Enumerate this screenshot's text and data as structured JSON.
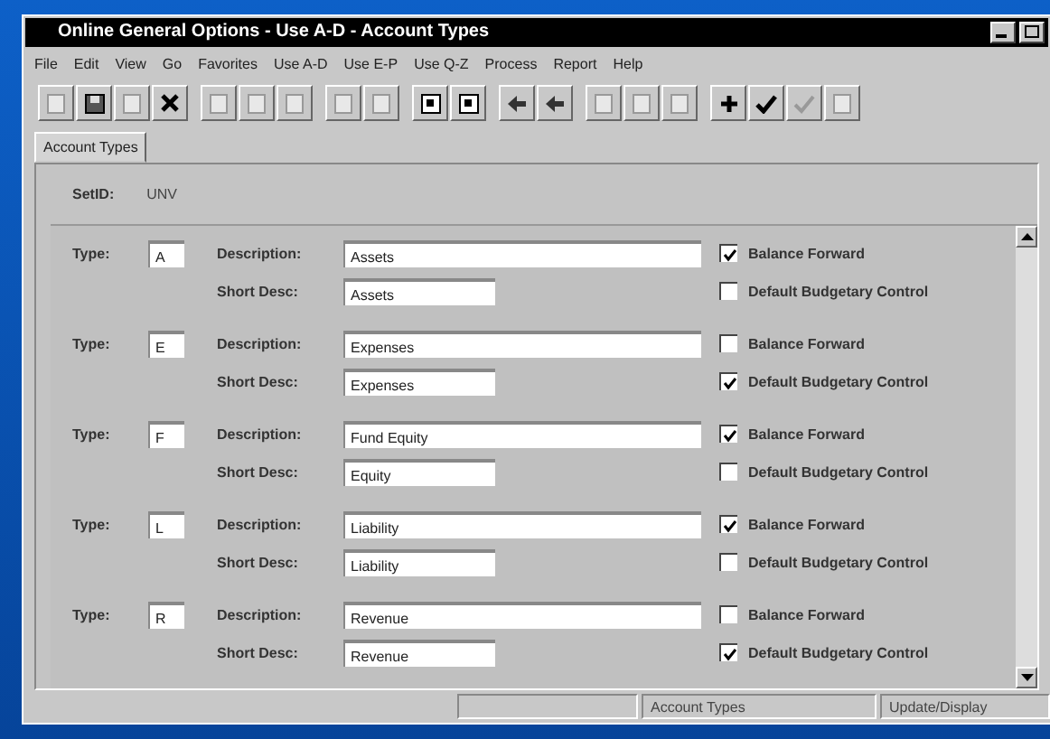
{
  "window": {
    "title": "Online General Options - Use A-D - Account Types"
  },
  "menu": [
    "File",
    "Edit",
    "View",
    "Go",
    "Favorites",
    "Use A-D",
    "Use E-P",
    "Use Q-Z",
    "Process",
    "Report",
    "Help"
  ],
  "tabs": [
    {
      "label": "Account Types",
      "selected": true
    }
  ],
  "setid": {
    "label": "SetID:",
    "value": "UNV"
  },
  "rows": [
    {
      "type_label": "Type:",
      "type": "A",
      "desc_label": "Description:",
      "desc": "Assets",
      "short_label": "Short Desc:",
      "short": "Assets",
      "checks": [
        {
          "label": "Balance Forward",
          "checked": true
        },
        {
          "label": "Default Budgetary Control",
          "checked": false
        }
      ]
    },
    {
      "type_label": "Type:",
      "type": "E",
      "desc_label": "Description:",
      "desc": "Expenses",
      "short_label": "Short Desc:",
      "short": "Expenses",
      "checks": [
        {
          "label": "Balance Forward",
          "checked": false
        },
        {
          "label": "Default Budgetary Control",
          "checked": true
        }
      ]
    },
    {
      "type_label": "Type:",
      "type": "F",
      "desc_label": "Description:",
      "desc": "Fund Equity",
      "short_label": "Short Desc:",
      "short": "Equity",
      "checks": [
        {
          "label": "Balance Forward",
          "checked": true
        },
        {
          "label": "Default Budgetary Control",
          "checked": false
        }
      ]
    },
    {
      "type_label": "Type:",
      "type": "L",
      "desc_label": "Description:",
      "desc": "Liability",
      "short_label": "Short Desc:",
      "short": "Liability",
      "checks": [
        {
          "label": "Balance Forward",
          "checked": true
        },
        {
          "label": "Default Budgetary Control",
          "checked": false
        }
      ]
    },
    {
      "type_label": "Type:",
      "type": "R",
      "desc_label": "Description:",
      "desc": "Revenue",
      "short_label": "Short Desc:",
      "short": "Revenue",
      "checks": [
        {
          "label": "Balance Forward",
          "checked": false
        },
        {
          "label": "Default Budgetary Control",
          "checked": true
        }
      ]
    }
  ],
  "status_bar": [
    "Account Types",
    "Update/Display"
  ]
}
